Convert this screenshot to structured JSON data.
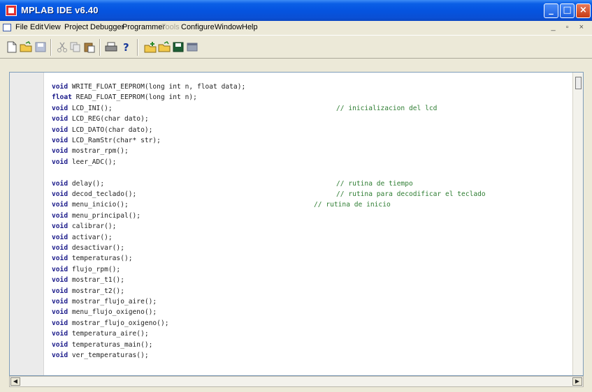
{
  "window": {
    "title": "MPLAB IDE v6.40",
    "controls": {
      "minimize": "_",
      "maximize": "□",
      "close": "×"
    }
  },
  "menu": {
    "items": [
      {
        "label": "File",
        "enabled": true
      },
      {
        "label": "Edit",
        "enabled": true
      },
      {
        "label": "View",
        "enabled": true
      },
      {
        "label": "Project",
        "enabled": true
      },
      {
        "label": "Debugger",
        "enabled": true
      },
      {
        "label": "Programmer",
        "enabled": true
      },
      {
        "label": "Tools",
        "enabled": false
      },
      {
        "label": "Configure",
        "enabled": true
      },
      {
        "label": "Window",
        "enabled": true
      },
      {
        "label": "Help",
        "enabled": true
      }
    ],
    "mdi_controls": "_ ▫ ×"
  },
  "toolbar": {
    "icons": [
      "new-file-icon",
      "open-folder-icon",
      "save-icon",
      "cut-icon",
      "copy-icon",
      "paste-icon",
      "print-icon",
      "help-icon",
      "new-project-icon",
      "open-project-icon",
      "save-workspace-icon",
      "project-window-icon"
    ]
  },
  "editor": {
    "lines": [
      {
        "kw": "void",
        "text": " WRITE_FLOAT_EEPROM(long int n, float data);",
        "comment": ""
      },
      {
        "kw": "float",
        "text": " READ_FLOAT_EEPROM(long int n);",
        "comment": ""
      },
      {
        "kw": "void",
        "text": " LCD_INI();",
        "comment": "// inicializacion del lcd"
      },
      {
        "kw": "void",
        "text": " LCD_REG(char dato);",
        "comment": ""
      },
      {
        "kw": "void",
        "text": " LCD_DATO(char dato);",
        "comment": ""
      },
      {
        "kw": "void",
        "text": " LCD_RamStr(char* str);",
        "comment": ""
      },
      {
        "kw": "void",
        "text": " mostrar_rpm();",
        "comment": ""
      },
      {
        "kw": "void",
        "text": " leer_ADC();",
        "comment": ""
      },
      {
        "kw": "",
        "text": "",
        "comment": ""
      },
      {
        "kw": "void",
        "text": " delay();",
        "comment": "// rutina de tiempo"
      },
      {
        "kw": "void",
        "text": " decod_teclado();",
        "comment": "// rutina para decodificar el teclado"
      },
      {
        "kw": "void",
        "text": " menu_inicio();",
        "comment": "// rutina de inicio"
      },
      {
        "kw": "void",
        "text": " menu_principal();",
        "comment": ""
      },
      {
        "kw": "void",
        "text": " calibrar();",
        "comment": ""
      },
      {
        "kw": "void",
        "text": " activar();",
        "comment": ""
      },
      {
        "kw": "void",
        "text": " desactivar();",
        "comment": ""
      },
      {
        "kw": "void",
        "text": " temperaturas();",
        "comment": ""
      },
      {
        "kw": "void",
        "text": " flujo_rpm();",
        "comment": ""
      },
      {
        "kw": "void",
        "text": " mostrar_t1();",
        "comment": ""
      },
      {
        "kw": "void",
        "text": " mostrar_t2();",
        "comment": ""
      },
      {
        "kw": "void",
        "text": " mostrar_flujo_aire();",
        "comment": ""
      },
      {
        "kw": "void",
        "text": " menu_flujo_oxigeno();",
        "comment": ""
      },
      {
        "kw": "void",
        "text": " mostrar_flujo_oxigeno();",
        "comment": ""
      },
      {
        "kw": "void",
        "text": " temperatura_aire();",
        "comment": ""
      },
      {
        "kw": "void",
        "text": " temperaturas_main();",
        "comment": ""
      },
      {
        "kw": "void",
        "text": " ver_temperaturas();",
        "comment": ""
      }
    ]
  },
  "colors": {
    "keyword": "#1a1a8a",
    "comment": "#2e7d32",
    "titlebar": "#0554e0"
  }
}
